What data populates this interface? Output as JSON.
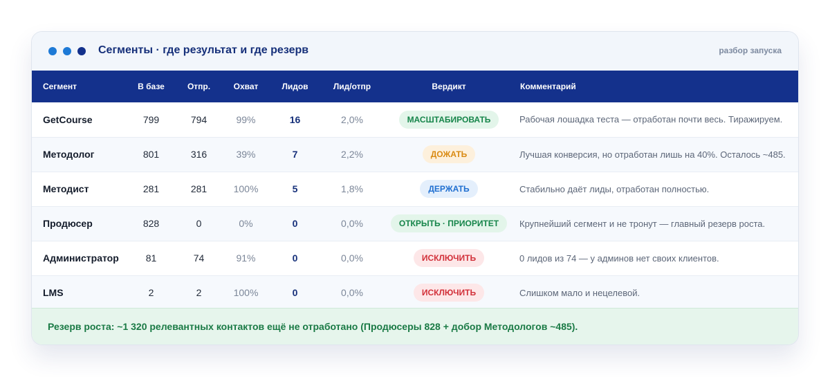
{
  "header": {
    "title": "Сегменты · где результат и где резерв",
    "badge": "разбор запуска",
    "dots": [
      {
        "name": "dot-1",
        "color": "#1e7ad6"
      },
      {
        "name": "dot-2",
        "color": "#1e7ad6"
      },
      {
        "name": "dot-3",
        "color": "#13318c"
      }
    ]
  },
  "columns": [
    "Сегмент",
    "В базе",
    "Отпр.",
    "Охват",
    "Лидов",
    "Лид/отпр",
    "Вердикт",
    "Комментарий"
  ],
  "rows": [
    {
      "segment": "GetCourse",
      "base": "799",
      "sent": "794",
      "reach": "99%",
      "leads": "16",
      "rate": "2,0%",
      "verdict": "МАСШТАБИРОВАТЬ",
      "verdict_kind": "green",
      "comment": "Рабочая лошадка теста — отработан почти весь. Тиражируем."
    },
    {
      "segment": "Методолог",
      "base": "801",
      "sent": "316",
      "reach": "39%",
      "leads": "7",
      "rate": "2,2%",
      "verdict": "ДОЖАТЬ",
      "verdict_kind": "orange",
      "comment": "Лучшая конверсия, но отработан лишь на 40%. Осталось ~485."
    },
    {
      "segment": "Методист",
      "base": "281",
      "sent": "281",
      "reach": "100%",
      "leads": "5",
      "rate": "1,8%",
      "verdict": "ДЕРЖАТЬ",
      "verdict_kind": "blue",
      "comment": "Стабильно даёт лиды, отработан полностью."
    },
    {
      "segment": "Продюсер",
      "base": "828",
      "sent": "0",
      "reach": "0%",
      "leads": "0",
      "rate": "0,0%",
      "verdict": "ОТКРЫТЬ · ПРИОРИТЕТ",
      "verdict_kind": "green",
      "comment": "Крупнейший сегмент и не тронут — главный резерв роста."
    },
    {
      "segment": "Администратор",
      "base": "81",
      "sent": "74",
      "reach": "91%",
      "leads": "0",
      "rate": "0,0%",
      "verdict": "ИСКЛЮЧИТЬ",
      "verdict_kind": "red",
      "comment": "0 лидов из 74 — у админов нет своих клиентов."
    },
    {
      "segment": "LMS",
      "base": "2",
      "sent": "2",
      "reach": "100%",
      "leads": "0",
      "rate": "0,0%",
      "verdict": "ИСКЛЮЧИТЬ",
      "verdict_kind": "red",
      "comment": "Слишком мало и нецелевой."
    }
  ],
  "verdict_colors": {
    "green": {
      "bg": "#e3f5ea",
      "fg": "#16854a"
    },
    "orange": {
      "bg": "#fdf0dc",
      "fg": "#d98a12"
    },
    "blue": {
      "bg": "#e4effc",
      "fg": "#1f6fd0"
    },
    "red": {
      "bg": "#fde7e8",
      "fg": "#d2313a"
    }
  },
  "footer": {
    "text": "Резерв роста: ~1 320 релевантных контактов ещё не отработано (Продюсеры 828 + добор Методологов ~485)."
  }
}
